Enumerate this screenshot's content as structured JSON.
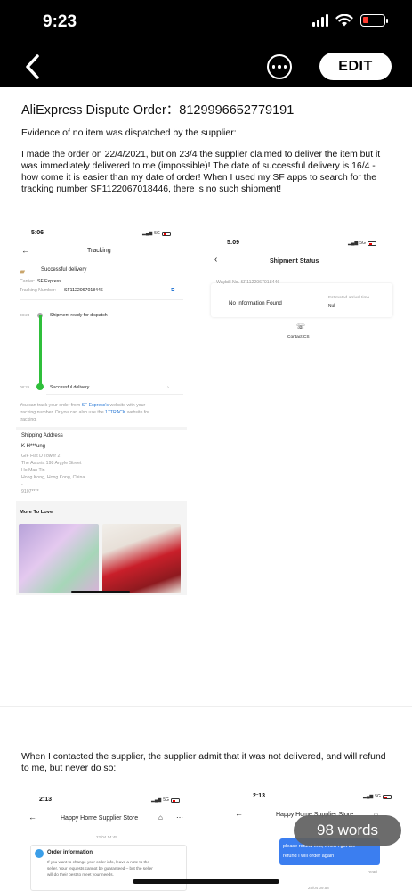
{
  "status_bar": {
    "time": "9:23"
  },
  "app_bar": {
    "edit_label": "EDIT"
  },
  "document": {
    "title": "AliExpress Dispute Order：8129996652779191",
    "subtitle": "Evidence of no item was dispatched by the supplier:",
    "body": "I made the order on 22/4/2021, but on 23/4 the supplier claimed to deliver the item but it was immediately delivered to me (impossible)! The date of successful delivery is 16/4 - how come it is easier than my date of order!  When I used my SF apps to search for the tracking number SF1122067018446, there is no such shipment!",
    "paragraph2": "When I contacted the supplier, the supplier admit that it was not delivered, and will refund to me, but never do so:"
  },
  "tracking_screenshot": {
    "time": "5:06",
    "network": "5G",
    "title": "Tracking",
    "delivery_status": "Successful delivery",
    "carrier_label": "Carrier:",
    "carrier": "SF Express",
    "tracking_label": "Tracking Number:",
    "tracking_number": "SF1122067018446",
    "event1_time": "08:23",
    "event1": "Shipment ready for dispatch",
    "event2_time": "08:26",
    "event2": "Successful delivery",
    "note_part1": "You can track your order from ",
    "note_link1": "SF Express's",
    "note_part2": " website with your",
    "note_line2_a": "tracking number. Or you can also use the ",
    "note_link2": "17TRACK",
    "note_line2_b": " website for",
    "note_line3": "tracking.",
    "shipping_title": "Shipping Address",
    "name": "K H***ung",
    "address1": "G/F Flat D Tower 2",
    "address2": "The Astoria 198 Argyle Street",
    "address3": "Ho Man Tin",
    "address4": "Hong Kong, Hong Kong, China",
    "phone": "9107****",
    "more_to_love": "More To Love"
  },
  "shipment_screenshot": {
    "time": "5:09",
    "network": "5G",
    "title": "Shipment Status",
    "waybill": "Waybill No. SF1122067018446",
    "no_info": "No Information Found",
    "eta_label": "Estimated arrival time",
    "eta_value": "Null",
    "contact": "Contact CS"
  },
  "store_screenshot": {
    "time": "2:13",
    "store_name": "Happy Home Supplier Store",
    "date": "22/04 14:45",
    "order_info_title": "Order information",
    "order_info_line1": "If you want to change your order info, leave a note to the",
    "order_info_line2": "seller. Your requests cannot be guaranteed – but the seller",
    "order_info_line3": "will do their best to meet your needs."
  },
  "chat_screenshot": {
    "time": "2:13",
    "store_name": "Happy Home Supplier Store",
    "bubble_line1": "please refund first, when I get the",
    "bubble_line2": "refund I will order again",
    "read": "Read",
    "date": "28/04 09:58"
  },
  "word_count": "98 words"
}
